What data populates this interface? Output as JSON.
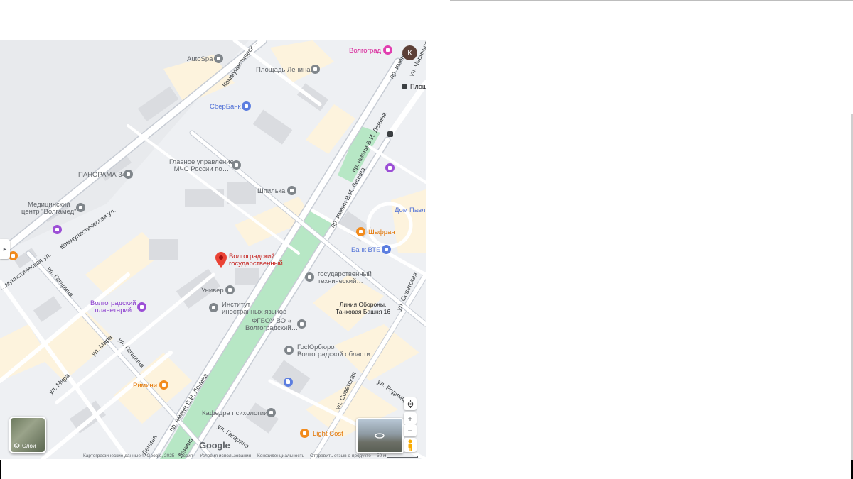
{
  "map": {
    "city_chip": "Волгоград",
    "avatar_letter": "К",
    "selected_place": [
      "Волгоградский",
      "государственный…"
    ],
    "pois": [
      {
        "id": "autospa",
        "lines": [
          "AutoSpa"
        ],
        "kind": "gray"
      },
      {
        "id": "ploshchad-lenina",
        "lines": [
          "Площадь Ленина"
        ],
        "kind": "gray"
      },
      {
        "id": "sberbank",
        "lines": [
          "СберБанк"
        ],
        "kind": "blue"
      },
      {
        "id": "panorama",
        "lines": [
          "ПАНОРАМА 34"
        ],
        "kind": "gray"
      },
      {
        "id": "mchs",
        "lines": [
          "Главное управление",
          "МЧС России по…"
        ],
        "kind": "gray"
      },
      {
        "id": "shpilka",
        "lines": [
          "Шпилька"
        ],
        "kind": "gray"
      },
      {
        "id": "volgamed",
        "lines": [
          "Медицинский",
          "центр \"Волгамед\""
        ],
        "kind": "gray"
      },
      {
        "id": "dom-pavlova",
        "lines": [
          "Дом Павло"
        ],
        "kind": "blue"
      },
      {
        "id": "shafran",
        "lines": [
          "Шафран"
        ],
        "kind": "orange"
      },
      {
        "id": "vtb",
        "lines": [
          "Банк ВТБ"
        ],
        "kind": "blue"
      },
      {
        "id": "tech-uni",
        "lines": [
          "государственный",
          "технический…"
        ],
        "kind": "gray"
      },
      {
        "id": "univer",
        "lines": [
          "Универ"
        ],
        "kind": "gray"
      },
      {
        "id": "planetarium",
        "lines": [
          "Волгоградский",
          "планетарий"
        ],
        "kind": "purple"
      },
      {
        "id": "foreign-lang",
        "lines": [
          "Институт",
          "иностранных языков"
        ],
        "kind": "gray"
      },
      {
        "id": "defense-line",
        "lines": [
          "Линия Обороны,",
          "Танковая Башня 16"
        ],
        "kind": "dark"
      },
      {
        "id": "fgbou",
        "lines": [
          "ФГБОУ ВО «",
          "Волгоградский…"
        ],
        "kind": "gray"
      },
      {
        "id": "gosyurburo",
        "lines": [
          "ГосЮрбюро",
          "Волгоградской области"
        ],
        "kind": "gray"
      },
      {
        "id": "rimini",
        "lines": [
          "Римини"
        ],
        "kind": "orange"
      },
      {
        "id": "psych-dept",
        "lines": [
          "Кафедра психологии"
        ],
        "kind": "gray"
      },
      {
        "id": "light-cost",
        "lines": [
          "Light Cost"
        ],
        "kind": "orange"
      },
      {
        "id": "ploshch-metro",
        "lines": [
          "Площ"
        ],
        "kind": "dark"
      }
    ],
    "streets": [
      "Коммунистическ…",
      "пр. имени В.И. Ленина",
      "пр. имени В.И. Ленина",
      "пр. имени В.И. Ленина",
      "Коммунистическая ул.",
      "…мунистическая ул.",
      "ул. Гагарина",
      "ул. Гагарина",
      "ул. Гагарина",
      "ул. Мира",
      "ул. Мира",
      "ул. Советская",
      "ул. Советская",
      "ул. Родимцев",
      "Ленина",
      "Ленина",
      "ул. Чернышевского",
      "пр. имени"
    ],
    "layers_label": "Слои",
    "parking_label": "P",
    "google_logo": "Google",
    "footer": {
      "copyright": "Картографические данные © Google, 2025",
      "country": "Россия",
      "terms": "Условия использования",
      "privacy": "Конфиденциальность",
      "feedback": "Отправить отзыв о продукте",
      "scale": "50 м"
    },
    "zoom_in": "+",
    "zoom_out": "−",
    "collapse": "▸"
  }
}
